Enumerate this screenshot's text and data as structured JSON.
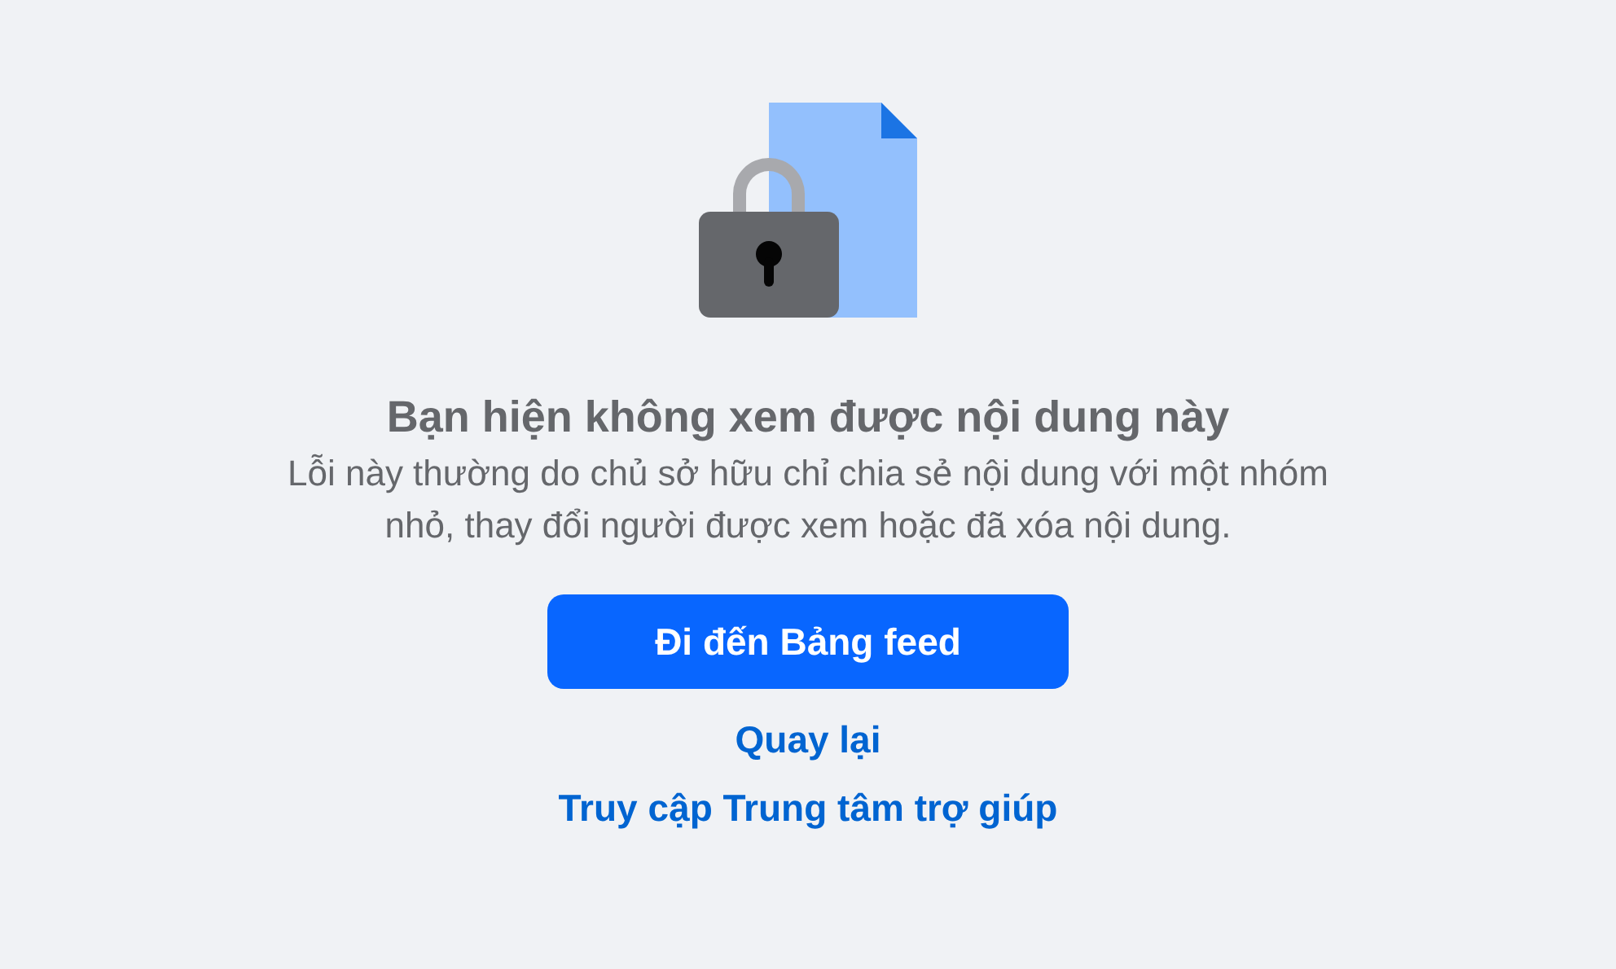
{
  "title": "Bạn hiện không xem được nội dung này",
  "message": "Lỗi này thường do chủ sở hữu chỉ chia sẻ nội dung với một nhóm nhỏ, thay đổi người được xem hoặc đã xóa nội dung.",
  "primary_button": "Đi đến Bảng feed",
  "links": [
    "Quay lại",
    "Truy cập Trung tâm trợ giúp"
  ]
}
